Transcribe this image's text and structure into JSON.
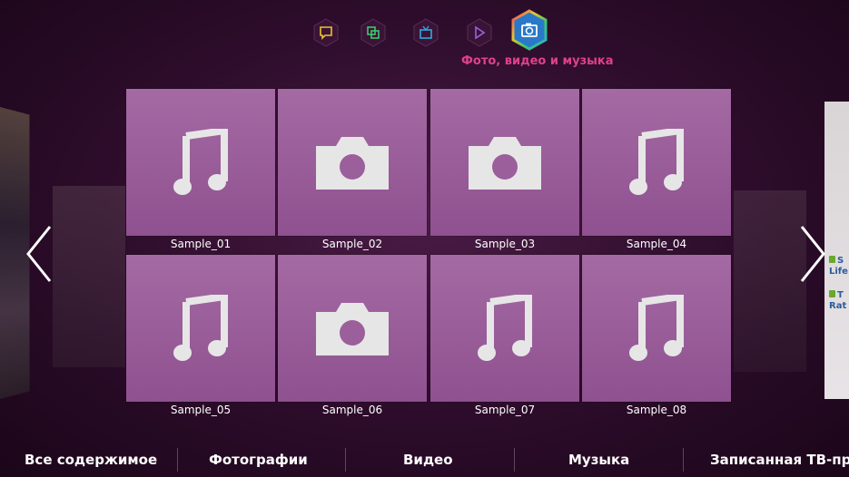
{
  "nav": {
    "icons": [
      "chat-icon",
      "apps-icon",
      "tv-icon",
      "play-icon",
      "camera-icon"
    ],
    "active_caption": "Фото, видео и музыка"
  },
  "grid": {
    "items": [
      {
        "label": "Sample_01",
        "type": "music"
      },
      {
        "label": "Sample_02",
        "type": "photo"
      },
      {
        "label": "Sample_03",
        "type": "photo"
      },
      {
        "label": "Sample_04",
        "type": "music"
      },
      {
        "label": "Sample_05",
        "type": "music"
      },
      {
        "label": "Sample_06",
        "type": "photo"
      },
      {
        "label": "Sample_07",
        "type": "music"
      },
      {
        "label": "Sample_08",
        "type": "music"
      }
    ]
  },
  "side_right": {
    "items": [
      {
        "line1": "S",
        "line2": "Life"
      },
      {
        "line1": "T",
        "line2": "Rat"
      }
    ]
  },
  "tabs": [
    "Все содержимое",
    "Фотографии",
    "Видео",
    "Музыка",
    "Записанная ТВ-пр"
  ],
  "colors": {
    "accent": "#e0408a",
    "tile": "#9b5f9b",
    "background": "#2c0c2a"
  }
}
